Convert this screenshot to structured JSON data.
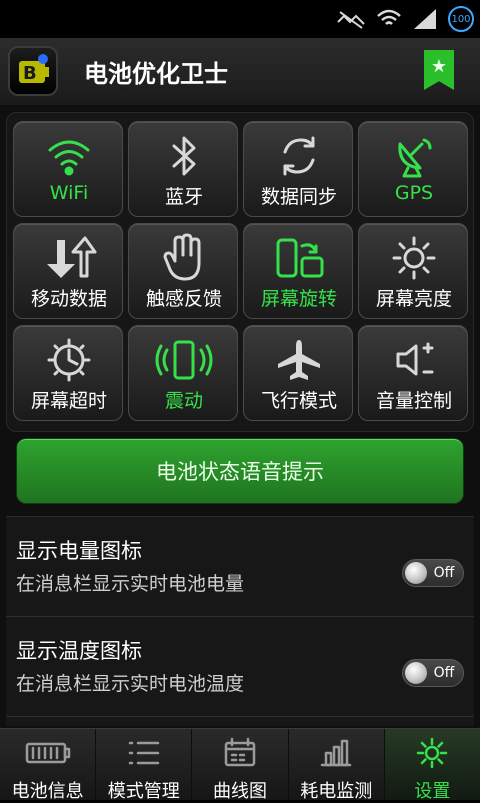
{
  "status_bar": {
    "battery_level": "100",
    "icons": [
      "no-signal-icon",
      "wifi-icon",
      "cell-signal-icon",
      "battery-icon"
    ]
  },
  "app_bar": {
    "title": "电池优化卫士",
    "logo_icon": "battery-logo-icon",
    "bookmark_icon": "star-bookmark-icon"
  },
  "toggles": [
    {
      "label": "WiFi",
      "icon": "wifi-icon",
      "active": true
    },
    {
      "label": "蓝牙",
      "icon": "bluetooth-icon",
      "active": false
    },
    {
      "label": "数据同步",
      "icon": "sync-icon",
      "active": false
    },
    {
      "label": "GPS",
      "icon": "gps-dish-icon",
      "active": true
    },
    {
      "label": "移动数据",
      "icon": "mobile-data-icon",
      "active": false
    },
    {
      "label": "触感反馈",
      "icon": "haptic-hand-icon",
      "active": false
    },
    {
      "label": "屏幕旋转",
      "icon": "screen-rotate-icon",
      "active": true
    },
    {
      "label": "屏幕亮度",
      "icon": "brightness-icon",
      "active": false
    },
    {
      "label": "屏幕超时",
      "icon": "timeout-icon",
      "active": false
    },
    {
      "label": "震动",
      "icon": "vibrate-icon",
      "active": true
    },
    {
      "label": "飞行模式",
      "icon": "airplane-icon",
      "active": false
    },
    {
      "label": "音量控制",
      "icon": "volume-icon",
      "active": false
    }
  ],
  "voice_button": {
    "label": "电池状态语音提示"
  },
  "settings": [
    {
      "title": "显示电量图标",
      "subtitle": "在消息栏显示实时电池电量",
      "toggle": "Off"
    },
    {
      "title": "显示温度图标",
      "subtitle": "在消息栏显示实时电池温度",
      "toggle": "Off"
    }
  ],
  "tabs": [
    {
      "label": "电池信息",
      "icon": "battery-info-icon",
      "active": false
    },
    {
      "label": "模式管理",
      "icon": "list-icon",
      "active": false
    },
    {
      "label": "曲线图",
      "icon": "calendar-chart-icon",
      "active": false
    },
    {
      "label": "耗电监测",
      "icon": "bar-chart-icon",
      "active": false
    },
    {
      "label": "设置",
      "icon": "gear-icon",
      "active": true
    }
  ],
  "colors": {
    "accent_green": "#35e14a",
    "button_green": "#2fa32f",
    "background": "#0f0f0f"
  }
}
